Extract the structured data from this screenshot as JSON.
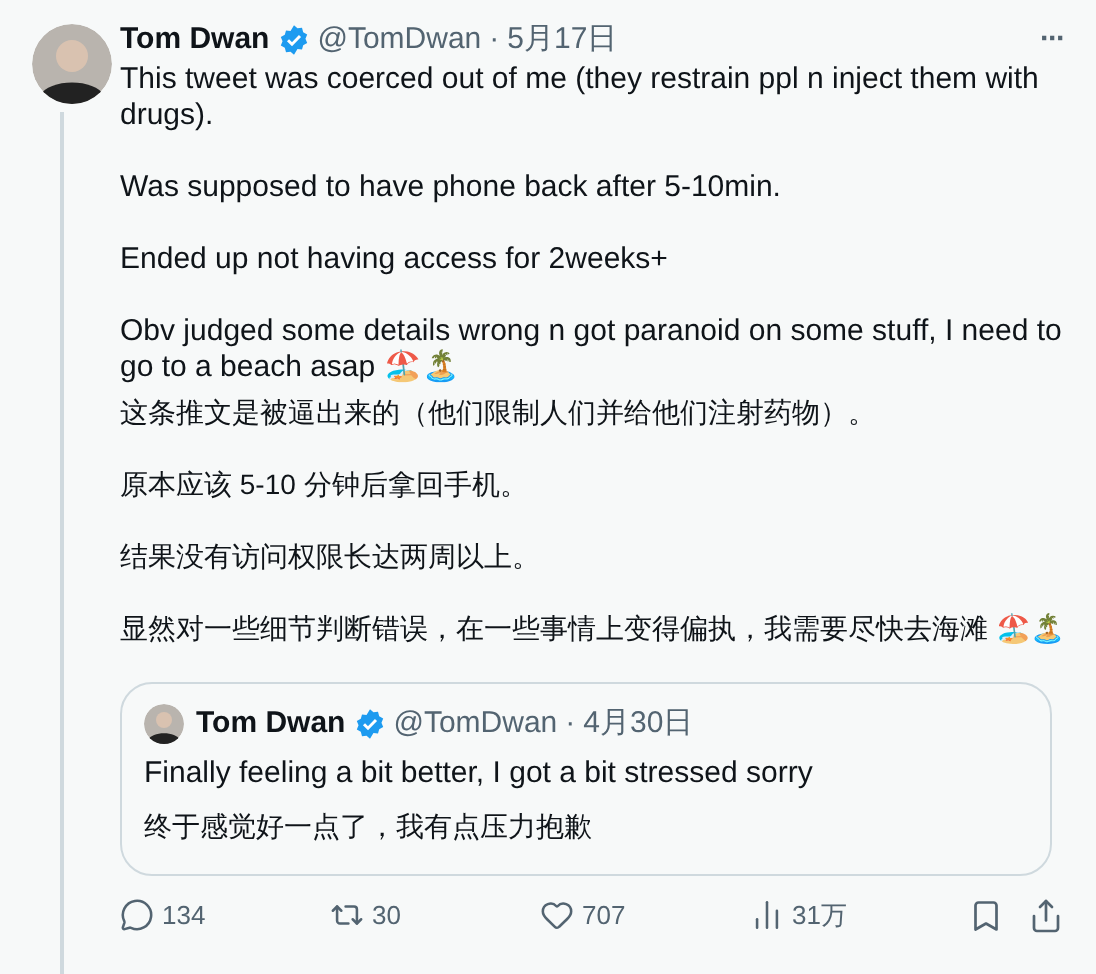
{
  "tweet": {
    "name": "Tom Dwan",
    "handle": "@TomDwan",
    "separator": "·",
    "date": "5月17日",
    "verified": true,
    "more": "···",
    "paragraphs": [
      "This tweet was coerced out of me (they restrain ppl n inject them with drugs).",
      "Was supposed to have phone back after 5-10min.",
      "Ended up not having access for 2weeks+",
      "Obv judged some details wrong n got paranoid on some stuff, I need to go to a beach asap 🏖️🏝️"
    ],
    "translation": [
      "这条推文是被逼出来的（他们限制人们并给他们注射药物）。",
      "原本应该 5-10 分钟后拿回手机。",
      "结果没有访问权限长达两周以上。",
      "显然对一些细节判断错误，在一些事情上变得偏执，我需要尽快去海滩 🏖️🏝️"
    ],
    "quote": {
      "name": "Tom Dwan",
      "handle": "@TomDwan",
      "separator": "·",
      "date": "4月30日",
      "verified": true,
      "text": "Finally feeling a bit better, I got a bit stressed sorry",
      "translation": "终于感觉好一点了，我有点压力抱歉"
    },
    "actions": [
      {
        "kind": "reply",
        "count": "134"
      },
      {
        "kind": "retweet",
        "count": "30"
      },
      {
        "kind": "like",
        "count": "707"
      },
      {
        "kind": "views",
        "count": "31万"
      }
    ]
  }
}
